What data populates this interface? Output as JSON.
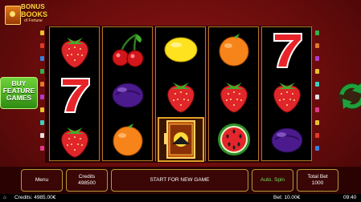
{
  "logo": {
    "line1": "BONUS",
    "line2": "BOOKS",
    "line3": "of Fortune"
  },
  "buy_feature": {
    "label_lines": [
      "BUY",
      "FEATURE",
      "GAMES"
    ]
  },
  "reels": [
    [
      "strawberry",
      "seven",
      "strawberry"
    ],
    [
      "cherry",
      "plum",
      "orange"
    ],
    [
      "lemon",
      "strawberry",
      "book-scatter"
    ],
    [
      "orange",
      "strawberry",
      "watermelon"
    ],
    [
      "seven",
      "strawberry",
      "plum"
    ]
  ],
  "panel": {
    "menu_label": "Menu",
    "credits_label": "Credits",
    "credits_value": "498500",
    "start_label": "START FOR NEW GAME",
    "auto_spin_label": "Auto. Spin",
    "total_bet_label": "Total Bet",
    "total_bet_value": "1000"
  },
  "status_bar": {
    "credits": "Credits: 4985.00€",
    "bet": "Bet: 10.00€",
    "time": "09:40"
  },
  "colors": {
    "background": "#6a0d0d",
    "reel_border": "#b57a22",
    "buy_button": "#4fb428",
    "auto_spin_text": "#6fe35a",
    "spin_icon": "#1ea03a"
  },
  "icons": {
    "spin": "circular-arrows-icon"
  }
}
